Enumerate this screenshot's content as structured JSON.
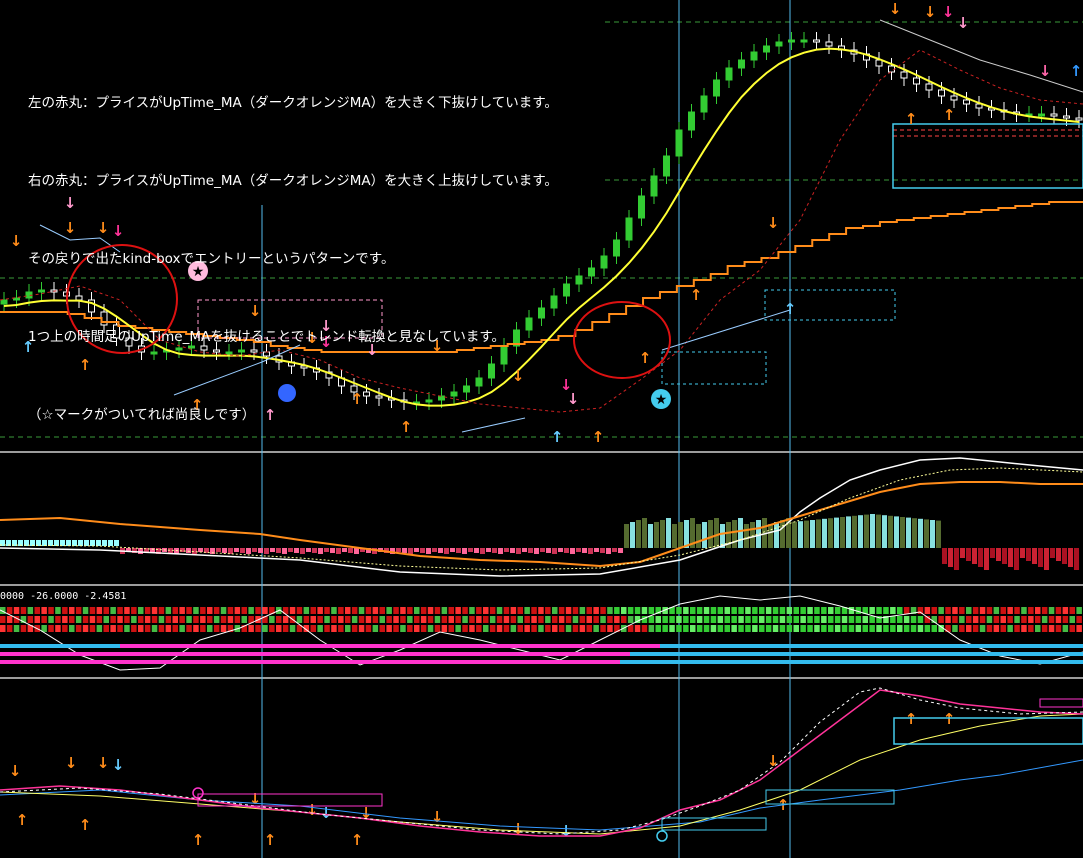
{
  "annotations": [
    "左の赤丸：プライスがUpTime_MA（ダークオレンジMA）を大きく下抜けしています。",
    "右の赤丸：プライスがUpTime_MA（ダークオレンジMA）を大きく上抜けしています。",
    "その戻りで出たkind-boxでエントリーというパターンです。",
    "1つ上の時間足のUpTime_MAを抜けることでトレンド転換と見なしています。",
    "（☆マークがついてれば尚良しです）"
  ],
  "indicator_readout": "0000 -26.0000 -2.4581",
  "colors": {
    "background": "#000000",
    "candle_up": "#33cc33",
    "candle_down": "#ffffff",
    "fast_ma": "#ffff33",
    "uptime_ma": "#ff8c1a",
    "red_circle": "#dd1111",
    "box_pink": "#ff99cc",
    "box_cyan": "#44ccee",
    "vline": "#55bbee",
    "arrow_orange": "#ff8c1a",
    "arrow_pink": "#ff66aa",
    "arrow_blue": "#66ccff"
  },
  "chart_data": [
    {
      "type": "candlestick",
      "panel": "price",
      "title": "",
      "series": [
        {
          "name": "",
          "values": [
            300,
            298,
            292,
            290,
            292,
            296,
            300,
            312,
            325,
            338,
            346,
            352,
            352,
            350,
            348,
            346,
            350,
            352,
            352,
            350,
            352,
            356,
            362,
            366,
            368,
            372,
            378,
            386,
            392,
            396,
            398,
            400,
            402,
            402,
            400,
            396,
            392,
            386,
            378,
            364,
            346,
            330,
            318,
            308,
            296,
            284,
            276,
            268,
            256,
            240,
            218,
            196,
            176,
            156,
            130,
            112,
            96,
            80,
            68,
            60,
            52,
            46,
            42,
            40,
            40,
            42,
            46,
            50,
            54,
            60,
            66,
            72,
            78,
            84,
            90,
            96,
            100,
            104,
            108,
            110,
            112,
            114,
            114,
            114,
            116,
            118,
            120
          ]
        },
        {
          "name": "",
          "values": [
            312,
            312,
            312,
            312,
            314,
            318,
            322,
            326,
            328,
            330,
            332,
            334,
            336,
            338,
            340,
            342,
            346,
            348,
            350,
            352,
            352,
            352,
            352,
            352,
            352,
            352,
            352,
            350,
            348,
            346,
            344,
            342,
            340,
            336,
            330,
            322,
            314,
            306,
            298,
            292,
            286,
            280,
            274,
            266,
            262,
            258,
            252,
            246,
            240,
            234,
            228,
            226,
            222,
            220,
            218,
            216,
            214,
            212,
            210,
            208,
            206,
            204,
            202,
            202,
            202
          ]
        }
      ]
    },
    {
      "type": "histogram",
      "panel": "oscillator",
      "title": ""
    },
    {
      "type": "heatmap",
      "panel": "signal_grid",
      "title": ""
    },
    {
      "type": "line",
      "panel": "lower",
      "title": ""
    }
  ]
}
